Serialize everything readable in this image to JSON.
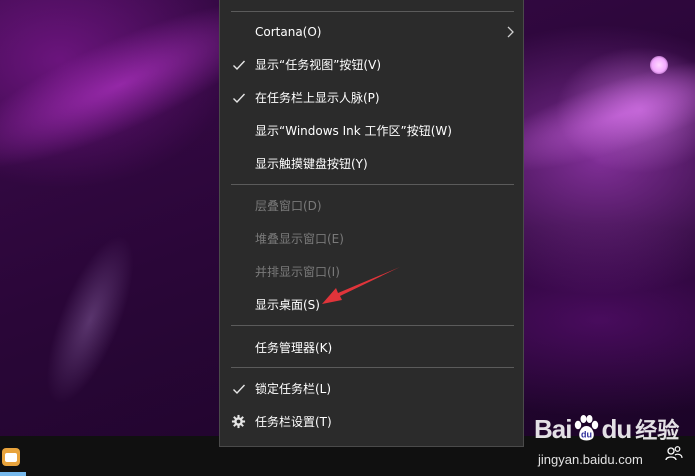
{
  "menu": {
    "items": [
      {
        "label": "Cortana(O)",
        "submenu": true
      },
      {
        "label": "显示“任务视图”按钮(V)",
        "checked": true
      },
      {
        "label": "在任务栏上显示人脉(P)",
        "checked": true
      },
      {
        "label": "显示“Windows Ink 工作区”按钮(W)"
      },
      {
        "label": "显示触摸键盘按钮(Y)"
      },
      {
        "label": "层叠窗口(D)",
        "disabled": true
      },
      {
        "label": "堆叠显示窗口(E)",
        "disabled": true
      },
      {
        "label": "并排显示窗口(I)",
        "disabled": true
      },
      {
        "label": "显示桌面(S)"
      },
      {
        "label": "任务管理器(K)"
      },
      {
        "label": "锁定任务栏(L)",
        "checked": true
      },
      {
        "label": "任务栏设置(T)",
        "icon": "gear-icon"
      }
    ]
  },
  "taskbar": {
    "pinned_icon": "store-icon",
    "tray_icon": "people-icon"
  },
  "watermark": {
    "brand_left": "Bai",
    "brand_right": "du",
    "product": "经验",
    "url": "jingyan.baidu.com"
  },
  "annotation": {
    "arrow_color": "#e0343a"
  }
}
